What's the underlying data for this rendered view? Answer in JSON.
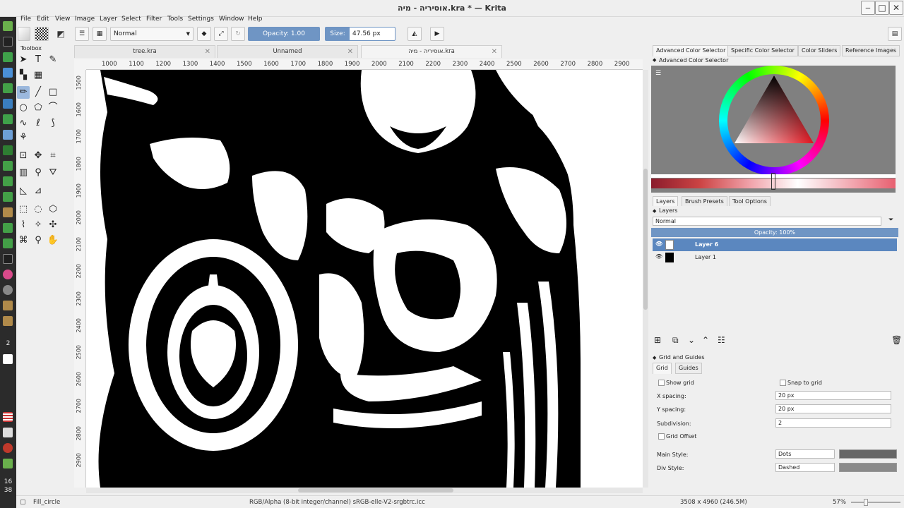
{
  "window": {
    "title": "אוסיריה - מיה.kra * — Krita",
    "min": "‒",
    "max": "□",
    "close": "✕"
  },
  "menu": [
    "File",
    "Edit",
    "View",
    "Image",
    "Layer",
    "Select",
    "Filter",
    "Tools",
    "Settings",
    "Window",
    "Help"
  ],
  "toolbar": {
    "blend_mode": "Normal",
    "opacity_label": "Opacity:",
    "opacity_value": "1.00",
    "size_label": "Size:",
    "size_value": "47.56 px"
  },
  "toolbox": {
    "title": "Toolbox"
  },
  "tabs": [
    {
      "label": "tree.kra",
      "close": "✕"
    },
    {
      "label": "Unnamed",
      "close": "✕"
    },
    {
      "label": "אוסיריה - מיה.kra",
      "close": "✕"
    }
  ],
  "ruler": {
    "h": [
      "1000",
      "1100",
      "1200",
      "1300",
      "1400",
      "1500",
      "1600",
      "1700",
      "1800",
      "1900",
      "2000",
      "2100",
      "2200",
      "2300",
      "2400",
      "2500",
      "2600",
      "2700",
      "2800",
      "2900"
    ],
    "v": [
      "1500",
      "1600",
      "1700",
      "1800",
      "1900",
      "2000",
      "2100",
      "2200",
      "2300",
      "2400",
      "2500",
      "2600",
      "2700",
      "2800",
      "2900"
    ]
  },
  "right_tabs_top": [
    "Advanced Color Selector",
    "Specific Color Selector",
    "Color Sliders",
    "Reference Images"
  ],
  "color_selector_title": "Advanced Color Selector",
  "right_tabs_mid": [
    "Layers",
    "Brush Presets",
    "Tool Options"
  ],
  "layers": {
    "title": "Layers",
    "blend": "Normal",
    "opacity": "Opacity:  100%",
    "items": [
      {
        "name": "Layer 6",
        "selected": true
      },
      {
        "name": "Layer 1",
        "selected": false
      }
    ]
  },
  "grid": {
    "title": "Grid and Guides",
    "tabs": [
      "Grid",
      "Guides"
    ],
    "show_grid": "Show grid",
    "snap_grid": "Snap to grid",
    "x_spacing_label": "X spacing:",
    "x_spacing": "20 px",
    "y_spacing_label": "Y spacing:",
    "y_spacing": "20 px",
    "subdivision_label": "Subdivision:",
    "subdivision": "2",
    "grid_offset": "Grid Offset",
    "main_style_label": "Main Style:",
    "main_style": "Dots",
    "div_style_label": "Div Style:",
    "div_style": "Dashed"
  },
  "status": {
    "tool": "Fill_circle",
    "color_model": "RGB/Alpha (8-bit integer/channel)  sRGB-elle-V2-srgbtrc.icc",
    "dimensions": "3508 x 4960 (246.5M)",
    "zoom": "57%"
  },
  "os": {
    "badge": "2",
    "clock_h": "16",
    "clock_m": "38"
  },
  "colors": {
    "accent": "#6f95c4",
    "selected_layer": "#5b87bf",
    "canvas_bg": "#808080"
  }
}
